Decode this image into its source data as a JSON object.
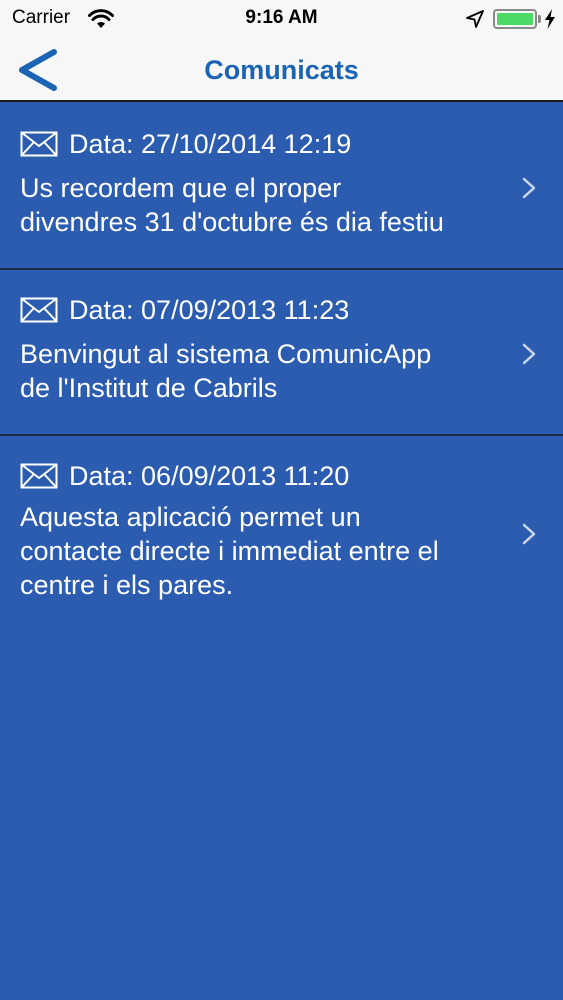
{
  "status_bar": {
    "carrier": "Carrier",
    "time": "9:16 AM",
    "battery_level": 1.0,
    "icons": [
      "wifi-icon",
      "location-arrow-icon",
      "battery-icon",
      "charging-bolt-icon"
    ]
  },
  "nav": {
    "title": "Comunicats",
    "back_icon": "chevron-left-icon"
  },
  "messages": [
    {
      "date": "Data: 27/10/2014 12:19",
      "lines": [
        "Us recordem que el proper",
        "divendres 31 d'octubre és dia festiu"
      ]
    },
    {
      "date": "Data: 07/09/2013 11:23",
      "lines": [
        "Benvingut al sistema ComunicApp",
        "de l'Institut de Cabrils"
      ]
    },
    {
      "date": "Data: 06/09/2013 11:20",
      "lines": [
        "Aquesta aplicació permet un",
        "contacte directe i immediat entre el",
        "centre i els pares."
      ]
    }
  ],
  "colors": {
    "accent": "#1b63b3",
    "background": "#2b5cb0",
    "bar": "#f7f7f7",
    "battery": "#4cd964",
    "text": "#ffffff"
  }
}
